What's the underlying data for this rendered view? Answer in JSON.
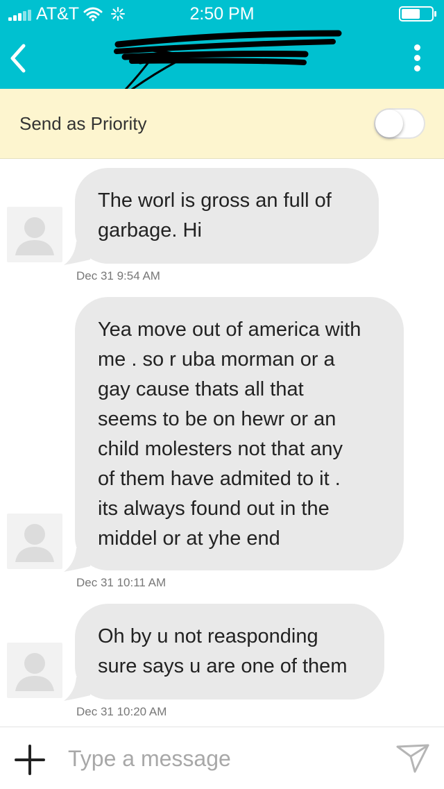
{
  "status_bar": {
    "carrier": "AT&T",
    "time": "2:50 PM",
    "icons": [
      "signal-icon",
      "wifi-icon",
      "activity-icon",
      "battery-icon"
    ]
  },
  "header": {
    "title": "",
    "icons": {
      "back": "chevron-left-icon",
      "menu": "more-vertical-icon"
    }
  },
  "priority": {
    "label": "Send as Priority",
    "enabled": false
  },
  "messages": [
    {
      "text": "The worl is gross an full of\ngarbage.   Hi",
      "timestamp": "Dec 31 9:54 AM"
    },
    {
      "text": "Yea move out of america with\nme . so r uba morman or a\ngay cause thats all that\nseems to be on hewr or an\nchild molesters not that any\nof them have admited to it .\nits always found out in the\nmiddel or at yhe end",
      "timestamp": "Dec 31 10:11 AM"
    },
    {
      "text": "Oh by u not reasponding\nsure says u are one of them",
      "timestamp": "Dec 31 10:20 AM"
    }
  ],
  "composer": {
    "placeholder": "Type a message",
    "value": "",
    "icons": {
      "add": "plus-icon",
      "send": "send-icon"
    }
  },
  "colors": {
    "header_bg": "#00c1d0",
    "priority_bg": "#fdf5cf",
    "bubble_bg": "#e9e9e9",
    "timestamp": "#777777",
    "placeholder": "#a8a8a8"
  }
}
